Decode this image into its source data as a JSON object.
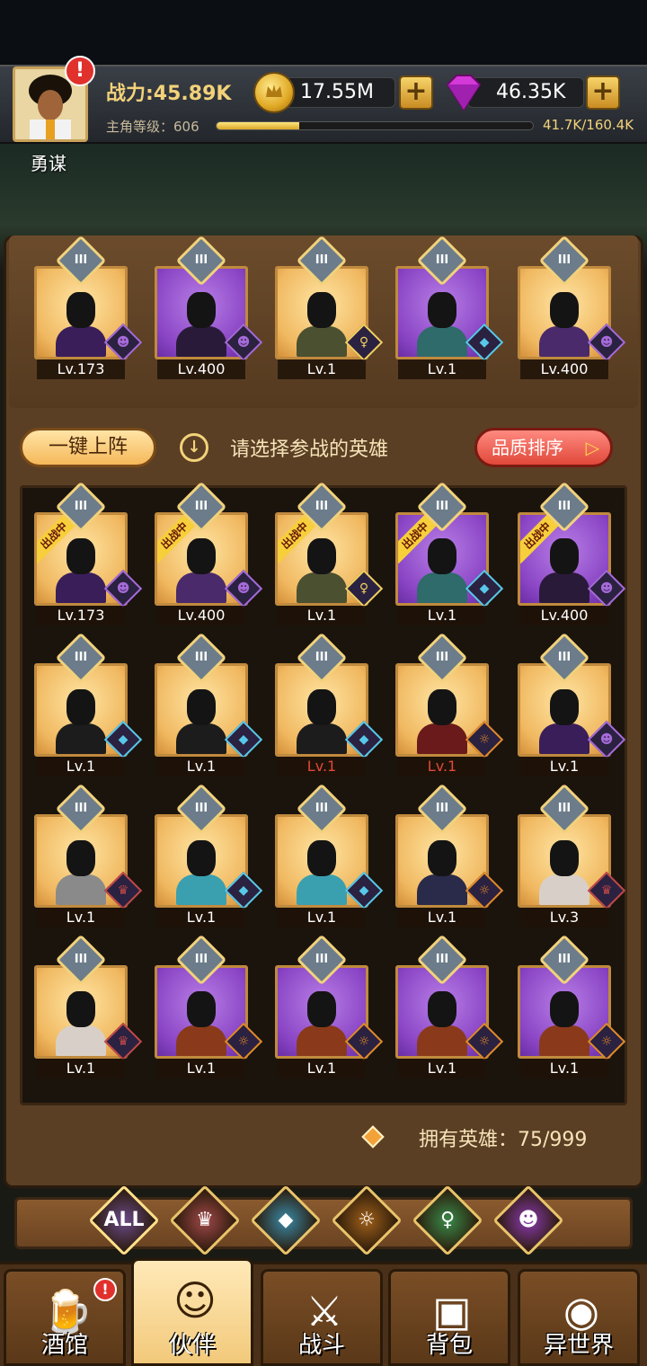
{
  "player": {
    "name": "勇谋",
    "power_label": "战力:45.89K",
    "level_label": "主角等级：606",
    "xp_text": "41.7K/160.4K",
    "xp_fraction": 0.26,
    "alert": "!"
  },
  "resources": {
    "gold": "17.55M",
    "gems": "46.35K",
    "plus": "+"
  },
  "controls": {
    "one_key_label": "一键上阵",
    "hint": "请选择参战的英雄",
    "sort_label": "品质排序",
    "sort_arrow": "▷",
    "owned": "拥有英雄：75/999"
  },
  "rank_badge": "III",
  "ribbon_text": "出战中",
  "team": [
    {
      "level": "Lv.173",
      "bg": "gold",
      "faction": "demon",
      "tone": "#3a1e5a"
    },
    {
      "level": "Lv.400",
      "bg": "purple",
      "faction": "demon",
      "tone": "#2a1a3a"
    },
    {
      "level": "Lv.1",
      "bg": "gold",
      "faction": "elf",
      "tone": "#4a5030"
    },
    {
      "level": "Lv.1",
      "bg": "purple",
      "faction": "water",
      "tone": "#2e6b6a"
    },
    {
      "level": "Lv.400",
      "bg": "gold",
      "faction": "demon",
      "tone": "#4a2a6a"
    }
  ],
  "heroes": [
    {
      "level": "Lv.173",
      "bg": "gold",
      "faction": "demon",
      "tone": "#3a1e5a",
      "deployed": true
    },
    {
      "level": "Lv.400",
      "bg": "gold",
      "faction": "demon",
      "tone": "#4a2a6a",
      "deployed": true
    },
    {
      "level": "Lv.1",
      "bg": "gold",
      "faction": "elf",
      "tone": "#4a5030",
      "deployed": true
    },
    {
      "level": "Lv.1",
      "bg": "purple",
      "faction": "water",
      "tone": "#2e6b6a",
      "deployed": true
    },
    {
      "level": "Lv.400",
      "bg": "purple",
      "faction": "demon",
      "tone": "#2a1a3a",
      "deployed": true
    },
    {
      "level": "Lv.1",
      "bg": "gold",
      "faction": "water",
      "tone": "#1c1c1c"
    },
    {
      "level": "Lv.1",
      "bg": "gold",
      "faction": "water",
      "tone": "#1c1c1c"
    },
    {
      "level": "Lv.1",
      "bg": "gold",
      "faction": "water",
      "tone": "#1c1c1c",
      "red": true
    },
    {
      "level": "Lv.1",
      "bg": "gold",
      "faction": "beast",
      "tone": "#6a1a1a",
      "red": true
    },
    {
      "level": "Lv.1",
      "bg": "gold",
      "faction": "demon",
      "tone": "#3a1e5a"
    },
    {
      "level": "Lv.1",
      "bg": "gold",
      "faction": "human",
      "tone": "#8a8a8a"
    },
    {
      "level": "Lv.1",
      "bg": "gold",
      "faction": "water",
      "tone": "#3aa0b0"
    },
    {
      "level": "Lv.1",
      "bg": "gold",
      "faction": "water",
      "tone": "#3aa0b0"
    },
    {
      "level": "Lv.1",
      "bg": "gold",
      "faction": "beast",
      "tone": "#2a2a4a"
    },
    {
      "level": "Lv.3",
      "bg": "gold",
      "faction": "human",
      "tone": "#d8d0c8"
    },
    {
      "level": "Lv.1",
      "bg": "gold",
      "faction": "human",
      "tone": "#d8d0c8"
    },
    {
      "level": "Lv.1",
      "bg": "purple",
      "faction": "beast",
      "tone": "#8a3a1a"
    },
    {
      "level": "Lv.1",
      "bg": "purple",
      "faction": "beast",
      "tone": "#8a3a1a"
    },
    {
      "level": "Lv.1",
      "bg": "purple",
      "faction": "beast",
      "tone": "#8a3a1a"
    },
    {
      "level": "Lv.1",
      "bg": "purple",
      "faction": "beast",
      "tone": "#8a3a1a"
    }
  ],
  "factions": {
    "demon": {
      "glyph": "☻",
      "color": "#a56ad8",
      "icon": "demon-faction-icon"
    },
    "elf": {
      "glyph": "♀",
      "color": "#f0d060",
      "icon": "elf-faction-icon"
    },
    "water": {
      "glyph": "◆",
      "color": "#58c8e8",
      "icon": "water-faction-icon"
    },
    "beast": {
      "glyph": "☼",
      "color": "#e08a2a",
      "icon": "beast-faction-icon"
    },
    "human": {
      "glyph": "♛",
      "color": "#c04848",
      "icon": "human-faction-icon"
    }
  },
  "filters": [
    {
      "label": "ALL",
      "color": "#6a4a8a",
      "icon": "all-filter"
    },
    {
      "label": "♛",
      "color": "#a04848",
      "icon": "human-filter-icon"
    },
    {
      "label": "◆",
      "color": "#3a8aa8",
      "icon": "water-filter-icon"
    },
    {
      "label": "☼",
      "color": "#a0601a",
      "icon": "beast-filter-icon"
    },
    {
      "label": "♀",
      "color": "#3a8a4a",
      "icon": "elf-filter-icon"
    },
    {
      "label": "☻",
      "color": "#8a3ab0",
      "icon": "demon-filter-icon"
    }
  ],
  "nav": [
    {
      "label": "酒馆",
      "icon": "tavern-icon",
      "glyph": "🍺",
      "alert": "!"
    },
    {
      "label": "伙伴",
      "icon": "partner-icon",
      "glyph": "☺",
      "active": true
    },
    {
      "label": "战斗",
      "icon": "battle-icon",
      "glyph": "⚔"
    },
    {
      "label": "背包",
      "icon": "backpack-icon",
      "glyph": "▣"
    },
    {
      "label": "异世界",
      "icon": "portal-icon",
      "glyph": "◉"
    }
  ]
}
